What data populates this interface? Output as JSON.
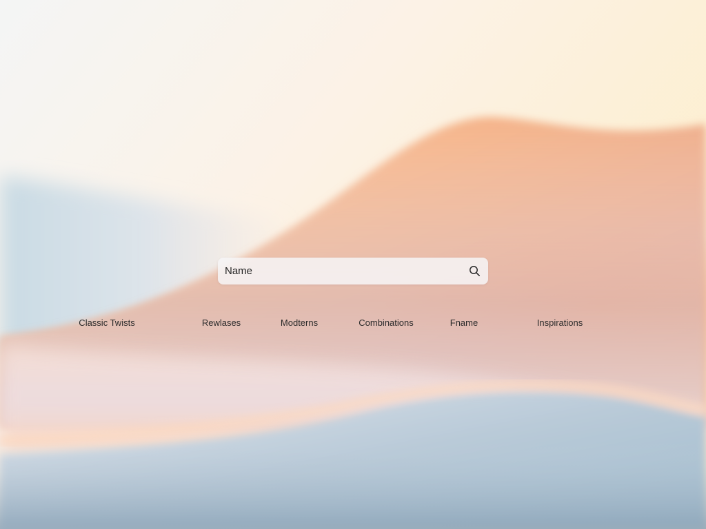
{
  "search": {
    "placeholder": "Name",
    "icon": "search-icon"
  },
  "nav": {
    "items": [
      {
        "label": "Classic Twists"
      },
      {
        "label": "Rewlases"
      },
      {
        "label": "Modterns"
      },
      {
        "label": "Combinations"
      },
      {
        "label": "Fname"
      },
      {
        "label": "Inspirations"
      }
    ]
  },
  "colors": {
    "sky_top_left": "#f6f3ef",
    "sky_top_right": "#fbeccb",
    "dune_orange": "#f3a874",
    "mist_blue": "#a9c3d4",
    "text": "#2b2b2b"
  }
}
